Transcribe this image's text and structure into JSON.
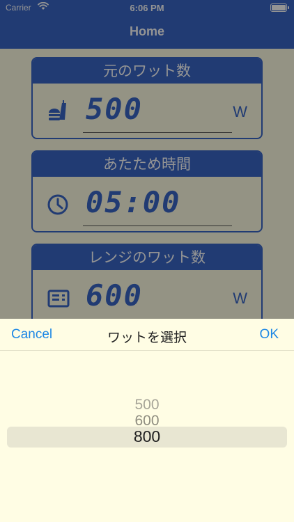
{
  "status_bar": {
    "carrier": "Carrier",
    "time": "6:06 PM"
  },
  "navbar": {
    "title": "Home"
  },
  "cards": [
    {
      "title": "元のワット数",
      "value": "500",
      "unit": "W",
      "icon": "food-icon"
    },
    {
      "title": "あたため時間",
      "value": "05:00",
      "unit": "",
      "icon": "clock-icon"
    },
    {
      "title": "レンジのワット数",
      "value": "600",
      "unit": "W",
      "icon": "microwave-icon"
    }
  ],
  "picker": {
    "title": "ワットを選択",
    "cancel_label": "Cancel",
    "ok_label": "OK",
    "options": [
      "500",
      "600",
      "800"
    ],
    "selected": "800"
  },
  "colors": {
    "accent": "#3a67c6",
    "link": "#1e88e5",
    "background": "#fffde4"
  }
}
